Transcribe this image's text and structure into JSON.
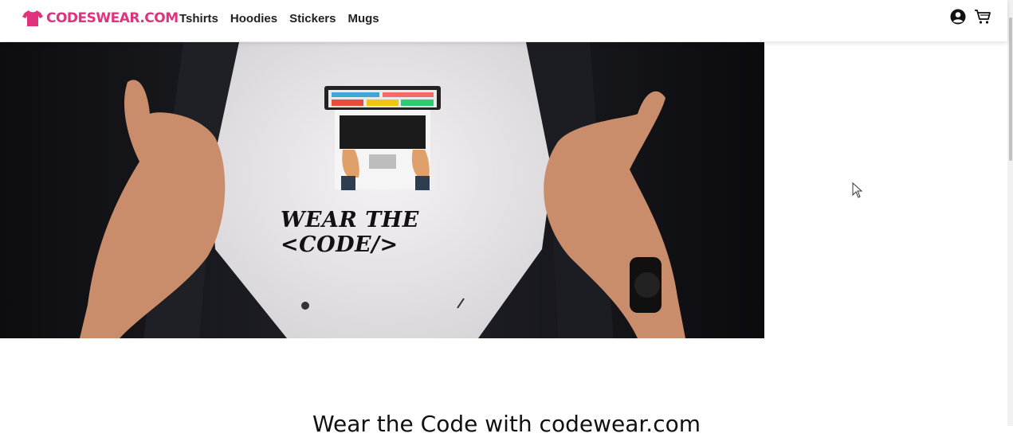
{
  "brand": {
    "name": "CODESWEAR.COM",
    "accent": "#e0337e"
  },
  "nav": {
    "links": [
      {
        "label": "Tshirts"
      },
      {
        "label": "Hoodies"
      },
      {
        "label": "Stickers"
      },
      {
        "label": "Mugs"
      }
    ],
    "icons": [
      "account-icon",
      "cart-icon"
    ]
  },
  "hero": {
    "banner_text": "Wear the <CODE/>"
  },
  "main": {
    "tagline": "Wear the Code with codewear.com"
  }
}
